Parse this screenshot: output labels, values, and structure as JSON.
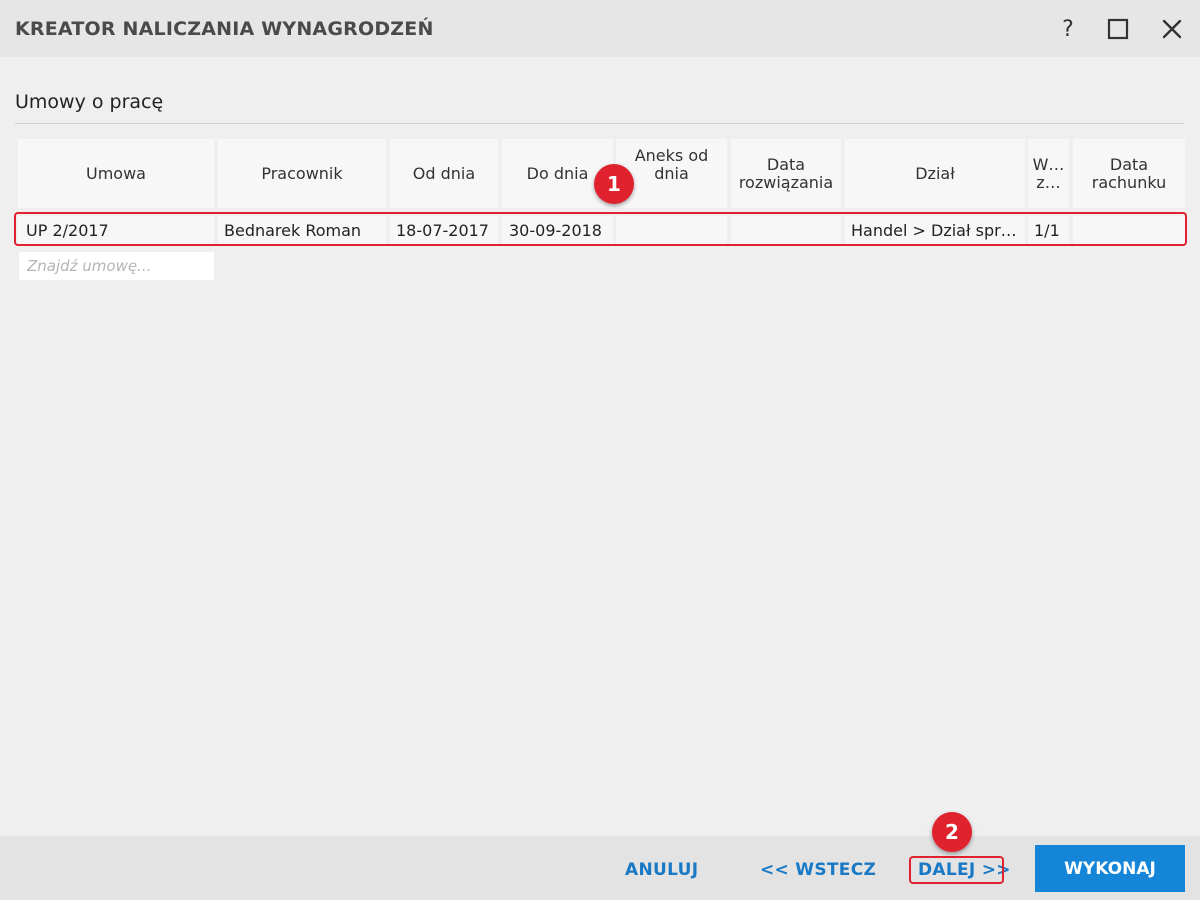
{
  "window": {
    "title": "KREATOR NALICZANIA WYNAGRODZEŃ",
    "help_glyph": "?",
    "icons": {
      "maximize": "maximize-icon",
      "close": "close-icon"
    }
  },
  "section": {
    "title": "Umowy o pracę"
  },
  "grid": {
    "columns": [
      "Umowa",
      "Pracownik",
      "Od dnia",
      "Do dnia",
      "Aneks od dnia",
      "Data rozwiązania",
      "Dział",
      "W… z…",
      "Data rachunku"
    ],
    "rows": [
      [
        "UP 2/2017",
        "Bednarek Roman",
        "18-07-2017",
        "30-09-2018",
        "",
        "",
        "Handel > Dział spr…",
        "1/1",
        ""
      ]
    ],
    "search_placeholder": "Znajdź umowę..."
  },
  "annotations": {
    "badge1": "1",
    "badge2": "2",
    "color": "#e0222e"
  },
  "footer": {
    "cancel_label": "ANULUJ",
    "back_label": "<< WSTECZ",
    "next_label": "DALEJ >>",
    "execute_label": "WYKONAJ"
  },
  "colors": {
    "accent": "#1979c4",
    "primary_button": "#1585d8"
  }
}
